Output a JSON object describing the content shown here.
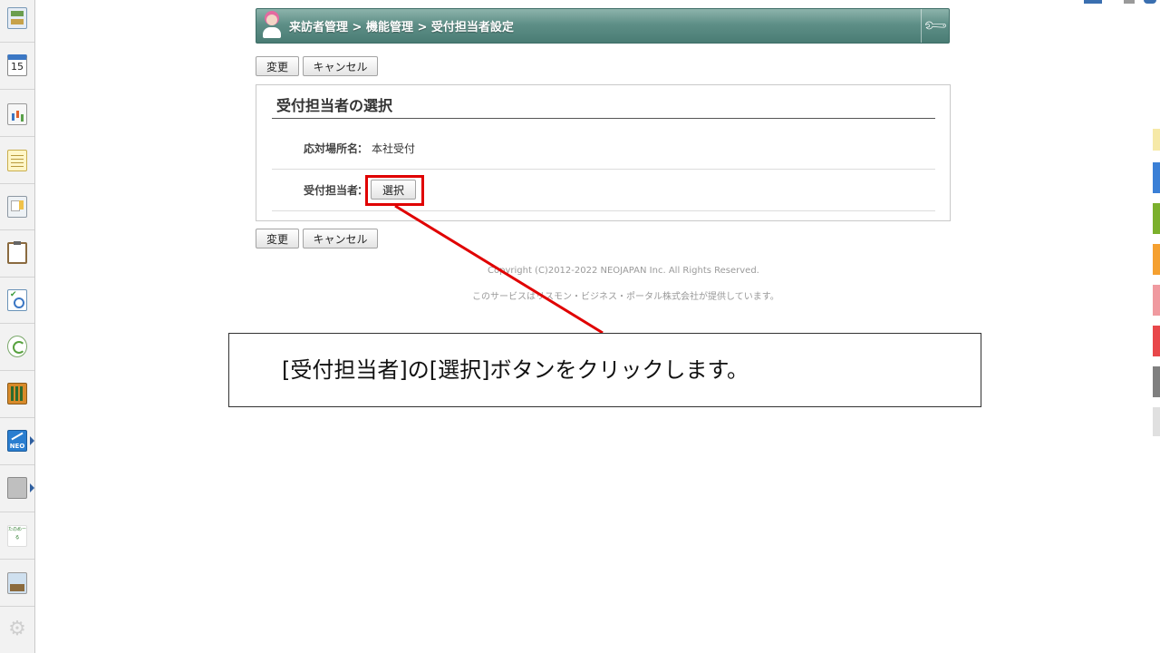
{
  "header": {
    "breadcrumb": "来訪者管理 > 機能管理 > 受付担当者設定",
    "avatar_icon": "receptionist-avatar-icon",
    "settings_icon": "wrench-icon"
  },
  "toolbar": {
    "change_label": "変更",
    "cancel_label": "キャンセル"
  },
  "panel": {
    "title": "受付担当者の選択",
    "fields": [
      {
        "label": "応対場所名",
        "value": "本社受付"
      },
      {
        "label": "受付担当者",
        "button_label": "選択"
      }
    ],
    "colon": "："
  },
  "footer": {
    "copyright": "Copyright (C)2012-2022 NEOJAPAN Inc. All Rights Reserved.",
    "service_note": "このサービスはリスモン・ビジネス・ポータル株式会社が提供しています。"
  },
  "callout": {
    "text": "[受付担当者]の[選択]ボタンをクリックします。",
    "highlight_color": "#e00000"
  },
  "rail": {
    "icons": [
      "dashboard-icon",
      "calendar-icon",
      "chart-icon",
      "memo-icon",
      "board-icon",
      "clipboard-icon",
      "survey-icon",
      "workflow-icon",
      "books-icon",
      "neo-icon",
      "folder-icon",
      "tanomail-icon",
      "photo-icon",
      "gear-icon"
    ],
    "calendar_day": "15",
    "neo_label": "NEO",
    "tanomail_label": "たのめーる"
  },
  "right_strip_colors": [
    "#f6e9a8",
    "#3a7fd6",
    "#7bb02c",
    "#f5a030",
    "#f09aa0",
    "#e8474a",
    "#7f7f7f",
    "#e0e0e0"
  ]
}
